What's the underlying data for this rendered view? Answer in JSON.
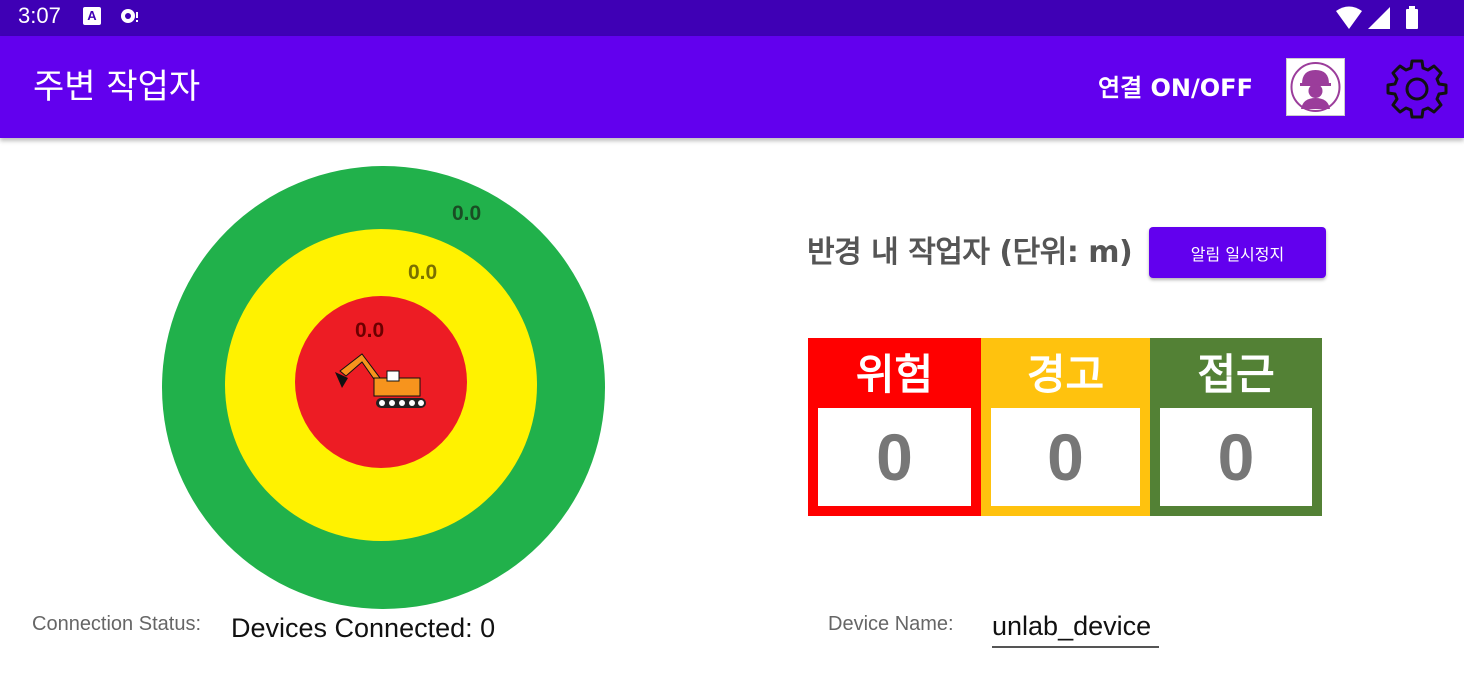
{
  "status_bar": {
    "time": "3:07",
    "icons": [
      "a-notification-icon",
      "record-icon",
      "wifi-icon",
      "signal-icon",
      "battery-icon"
    ]
  },
  "app_bar": {
    "title": "주변 작업자",
    "connect_label": "연결 ON/OFF",
    "worker_icon": "worker-helmet-icon",
    "settings_icon": "gear-icon",
    "color": "#6200ee"
  },
  "radar": {
    "distances": {
      "approach": "0.0",
      "warning": "0.0",
      "danger": "0.0"
    },
    "colors": {
      "outer": "#21b14b",
      "middle": "#fff200",
      "inner": "#ed1c24"
    },
    "center_icon": "excavator-icon"
  },
  "panel": {
    "title": "반경 내 작업자 (단위: m)",
    "pause_button": "알림 일시정지",
    "counters": [
      {
        "label": "위험",
        "value": "0",
        "color": "#ff0000"
      },
      {
        "label": "경고",
        "value": "0",
        "color": "#ffc20e"
      },
      {
        "label": "접근",
        "value": "0",
        "color": "#538135"
      }
    ]
  },
  "footer": {
    "connection_label": "Connection Status:",
    "connection_value": "Devices Connected: 0",
    "device_label": "Device Name:",
    "device_value": "unlab_device"
  }
}
